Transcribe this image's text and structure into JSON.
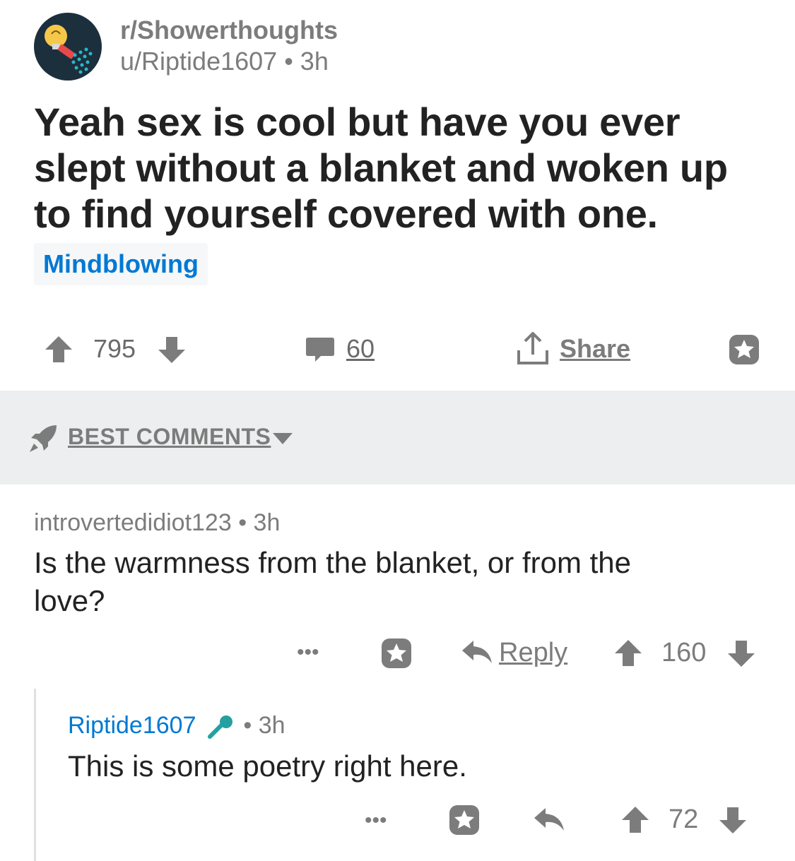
{
  "post": {
    "subreddit": "r/Showerthoughts",
    "author": "u/Riptide1607",
    "age": "• 3h",
    "title": "Yeah sex is cool but have you ever slept without a blanket and woken up to find yourself covered with one.",
    "flair": "Mindblowing",
    "score": "795",
    "comment_count": "60",
    "share_label": "Share"
  },
  "sort": {
    "label": "BEST COMMENTS"
  },
  "comments": [
    {
      "author": "introvertedidiot123",
      "age": "• 3h",
      "body": "Is the warmness from the blanket, or from the love?",
      "reply_label": "Reply",
      "score": "160",
      "more": "•••"
    },
    {
      "author": "Riptide1607",
      "age": "• 3h",
      "body": "This is some poetry right here.",
      "score": "72",
      "more": "•••"
    }
  ],
  "colors": {
    "text": "#222222",
    "meta": "#7c7c7c",
    "flair": "#0079d3",
    "op_author": "#0079d3",
    "op_mic": "#24a0a0",
    "sort_bar": "#edeeef",
    "avatar_bg": "#1c2f3d"
  }
}
